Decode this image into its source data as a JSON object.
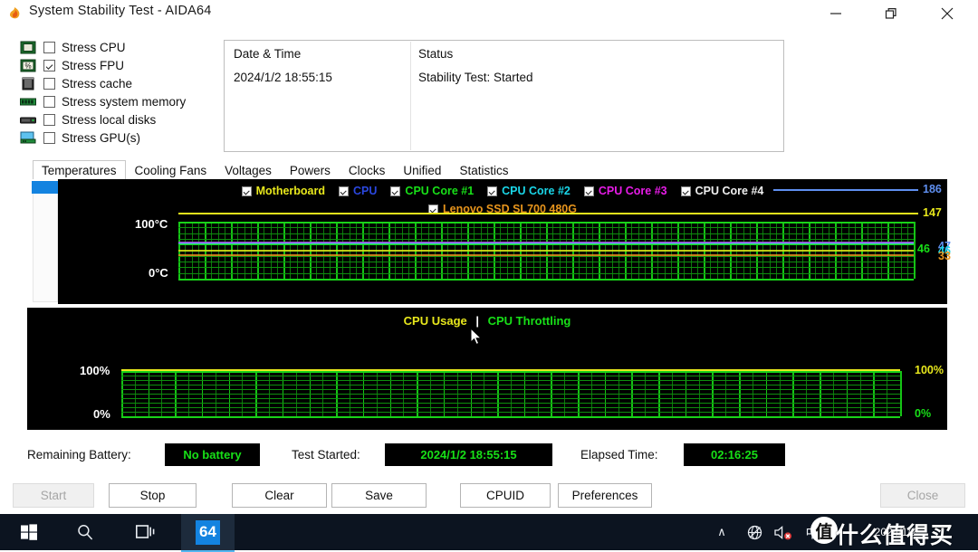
{
  "window": {
    "title": "System Stability Test - AIDA64",
    "icon": "aida64-flame-icon",
    "controls": [
      {
        "name": "minimize-button",
        "label": "—"
      },
      {
        "name": "restore-button",
        "label": "❐"
      },
      {
        "name": "close-button",
        "label": "✕"
      }
    ]
  },
  "stress_options": [
    {
      "icon": "cpu-chip-icon",
      "label": "Stress CPU",
      "checked": false
    },
    {
      "icon": "fpu-chip-icon",
      "label": "Stress FPU",
      "checked": true
    },
    {
      "icon": "cache-module-icon",
      "label": "Stress cache",
      "checked": false
    },
    {
      "icon": "memory-module-icon",
      "label": "Stress system memory",
      "checked": false
    },
    {
      "icon": "hard-disk-icon",
      "label": "Stress local disks",
      "checked": false
    },
    {
      "icon": "gpu-monitor-icon",
      "label": "Stress GPU(s)",
      "checked": false
    }
  ],
  "log_panel": {
    "columns": [
      "Date & Time",
      "Status"
    ],
    "rows": [
      {
        "datetime": "2024/1/2 18:55:15",
        "status": "Stability Test: Started"
      }
    ]
  },
  "tabs": [
    {
      "label": "Temperatures",
      "active": true
    },
    {
      "label": "Cooling Fans",
      "active": false
    },
    {
      "label": "Voltages",
      "active": false
    },
    {
      "label": "Powers",
      "active": false
    },
    {
      "label": "Clocks",
      "active": false
    },
    {
      "label": "Unified",
      "active": false
    },
    {
      "label": "Statistics",
      "active": false
    }
  ],
  "chart_data": [
    {
      "type": "line",
      "name": "temperatures-chart",
      "title": "",
      "ylabel": "",
      "ytick_labels": [
        "100°C",
        "0°C"
      ],
      "ylim": [
        0,
        100
      ],
      "grid": true,
      "legend_position": "top",
      "background": "#000000",
      "legend": [
        {
          "label": "Motherboard",
          "color": "#e8e81c",
          "checked": true
        },
        {
          "label": "CPU",
          "color": "#2b48e0",
          "checked": true
        },
        {
          "label": "CPU Core #1",
          "color": "#18e018",
          "checked": true
        },
        {
          "label": "CPU Core #2",
          "color": "#1ad6e8",
          "checked": true
        },
        {
          "label": "CPU Core #3",
          "color": "#e81ce8",
          "checked": true
        },
        {
          "label": "CPU Core #4",
          "color": "#f0f0f0",
          "checked": true
        },
        {
          "label": "Lenovo SSD SL700 480G",
          "color": "#e8951c",
          "checked": true
        }
      ],
      "top_markers": [
        {
          "value": "186",
          "color": "#5f8ff0"
        },
        {
          "value": "147",
          "color": "#e8e81c"
        }
      ],
      "right_values": [
        {
          "value": "46",
          "color": "#18e018"
        },
        {
          "value": "47",
          "color": "#5f8ff0"
        },
        {
          "value": "46",
          "color": "#1ad6e8"
        },
        {
          "value": "33",
          "color": "#e8951c"
        }
      ],
      "series": [
        {
          "name": "Motherboard",
          "color": "#e8e81c",
          "level_c": 40
        },
        {
          "name": "CPU",
          "color": "#2b48e0",
          "level_c": 47
        },
        {
          "name": "CPU Core #1",
          "color": "#18e018",
          "level_c": 46
        },
        {
          "name": "CPU Core #2",
          "color": "#1ad6e8",
          "level_c": 46
        },
        {
          "name": "CPU Core #3",
          "color": "#e81ce8",
          "level_c": 46
        },
        {
          "name": "CPU Core #4",
          "color": "#f0f0f0",
          "level_c": 47
        },
        {
          "name": "Lenovo SSD SL700 480G",
          "color": "#e8951c",
          "level_c": 33
        }
      ]
    },
    {
      "type": "line",
      "name": "cpu-usage-chart",
      "legend_text": {
        "usage": "CPU Usage",
        "separator": "|",
        "throttling": "CPU Throttling"
      },
      "legend_colors": {
        "usage": "#e8e81c",
        "separator": "#ffffff",
        "throttling": "#18e018"
      },
      "ytick_labels": [
        "100%",
        "0%"
      ],
      "right_labels": [
        {
          "value": "100%",
          "color": "#e8e81c"
        },
        {
          "value": "0%",
          "color": "#18e018"
        }
      ],
      "ylim": [
        0,
        100
      ],
      "grid": true,
      "background": "#000000",
      "series": [
        {
          "name": "CPU Usage",
          "color": "#e8e81c",
          "level_pct": 100
        },
        {
          "name": "CPU Throttling",
          "color": "#18e018",
          "level_pct": 0
        }
      ]
    }
  ],
  "status": [
    {
      "name": "remaining-battery",
      "label": "Remaining Battery:",
      "value": "No battery"
    },
    {
      "name": "test-started",
      "label": "Test Started:",
      "value": "2024/1/2 18:55:15"
    },
    {
      "name": "elapsed-time",
      "label": "Elapsed Time:",
      "value": "02:16:25"
    }
  ],
  "buttons": [
    {
      "name": "start-button",
      "label": "Start",
      "disabled": true
    },
    {
      "name": "stop-button",
      "label": "Stop",
      "disabled": false
    },
    {
      "name": "clear-button",
      "label": "Clear",
      "disabled": false
    },
    {
      "name": "save-button",
      "label": "Save",
      "disabled": false
    },
    {
      "name": "cpuid-button",
      "label": "CPUID",
      "disabled": false
    },
    {
      "name": "preferences-button",
      "label": "Preferences",
      "disabled": false
    },
    {
      "name": "close-dialog-button",
      "label": "Close",
      "disabled": true
    }
  ],
  "taskbar": {
    "start_icon": "windows-logo-icon",
    "search_icon": "search-icon",
    "taskview_icon": "task-view-icon",
    "app_icon_label": "64",
    "tray": {
      "chevron": "∧",
      "network_icon": "network-disconnected-icon",
      "volume_icon": "volume-muted-icon",
      "ime_label": "中"
    },
    "clock": {
      "time": "",
      "date": "2024/1/2"
    }
  },
  "watermark": {
    "badge": "值",
    "text": "什么值得买"
  }
}
